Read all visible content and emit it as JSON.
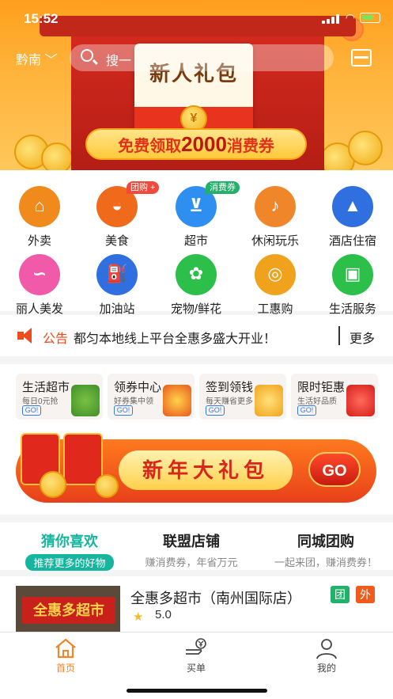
{
  "status_bar": {
    "time": "15:52"
  },
  "header": {
    "location": "黔南",
    "search_placeholder": "搜一"
  },
  "hero": {
    "title": "新人礼包",
    "coin_symbol": "¥",
    "ribbon_prefix": "免费领取",
    "ribbon_amount": "2000",
    "ribbon_suffix": "消费券"
  },
  "categories": [
    {
      "label": "外卖",
      "color": "#f08a1c",
      "glyph": "⌂"
    },
    {
      "label": "美食",
      "color": "#f06a1c",
      "glyph": "◒",
      "tag": "团购 +",
      "tag_color": "#f04a3a"
    },
    {
      "label": "超市",
      "color": "#2f8ff0",
      "glyph": "⊻",
      "tag": "消费券",
      "tag_color": "#22b06a"
    },
    {
      "label": "休闲玩乐",
      "color": "#f0862a",
      "glyph": "♪"
    },
    {
      "label": "酒店住宿",
      "color": "#2f6fe0",
      "glyph": "▲"
    },
    {
      "label": "丽人美发",
      "color": "#f05aa8",
      "glyph": "∽"
    },
    {
      "label": "加油站",
      "color": "#2f6fe0",
      "glyph": "⛽"
    },
    {
      "label": "宠物/鲜花",
      "color": "#2cbf4a",
      "glyph": "✿"
    },
    {
      "label": "工惠购",
      "color": "#f0a21c",
      "glyph": "◎"
    },
    {
      "label": "生活服务",
      "color": "#2cbf4a",
      "glyph": "▣"
    }
  ],
  "notice": {
    "tag": "公告",
    "text": "都匀本地线上平台全惠多盛大开业！",
    "more": "更多"
  },
  "promo_cards": [
    {
      "title": "生活超市",
      "subtitle": "每日0元抢",
      "go": "GO!"
    },
    {
      "title": "领券中心",
      "subtitle": "好券集中领",
      "go": "GO!"
    },
    {
      "title": "签到领钱",
      "subtitle": "每天赚省更多",
      "go": "GO!"
    },
    {
      "title": "限时钜惠",
      "subtitle": "生活好品质",
      "go": "GO!"
    }
  ],
  "new_year_banner": {
    "text": "新年大礼包",
    "go": "GO"
  },
  "tabs": [
    {
      "title": "猜你喜欢",
      "subtitle": "推荐更多的好物",
      "active": true
    },
    {
      "title": "联盟店铺",
      "subtitle": "赚消费券，年省万元",
      "active": false
    },
    {
      "title": "同城团购",
      "subtitle": "一起来团，赚消费券！",
      "active": false
    }
  ],
  "store": {
    "name": "全惠多超市（南州国际店）",
    "rating": "5.0",
    "sign_text": "全惠多超市",
    "badge_group": "团",
    "badge_takeout": "外",
    "badge_group_color": "#22b06a",
    "badge_takeout_color": "#f05a1c"
  },
  "bottom_nav": [
    {
      "label": "首页",
      "active": true
    },
    {
      "label": "买单",
      "active": false
    },
    {
      "label": "我的",
      "active": false
    }
  ]
}
